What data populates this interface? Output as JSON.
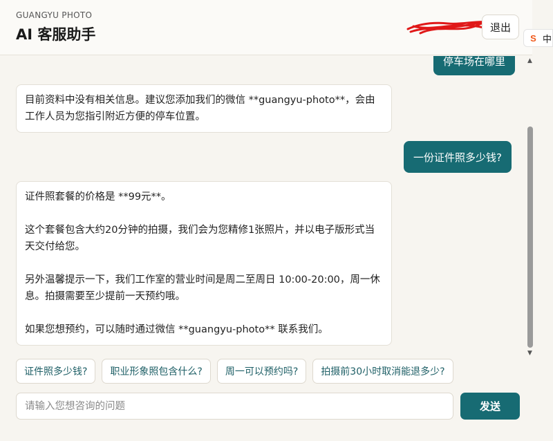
{
  "header": {
    "brand": "GUANGYU PHOTO",
    "title": "AI 客服助手",
    "logout_label": "退出"
  },
  "extension": {
    "icon_letter": "S",
    "label": "中"
  },
  "messages": [
    {
      "role": "user",
      "text": "停车场在哪里"
    },
    {
      "role": "assistant",
      "paragraphs": [
        "目前资料中没有相关信息。建议您添加我们的微信 **guangyu-photo**，会由工作人员为您指引附近方便的停车位置。"
      ]
    },
    {
      "role": "user",
      "text": "一份证件照多少钱?"
    },
    {
      "role": "assistant",
      "paragraphs": [
        "证件照套餐的价格是 **99元**。",
        "这个套餐包含大约20分钟的拍摄，我们会为您精修1张照片，并以电子版形式当天交付给您。",
        "另外温馨提示一下，我们工作室的营业时间是周二至周日 10:00-20:00，周一休息。拍摄需要至少提前一天预约哦。",
        "如果您想预约，可以随时通过微信 **guangyu-photo** 联系我们。"
      ]
    }
  ],
  "suggestions": [
    "证件照多少钱?",
    "职业形象照包含什么?",
    "周一可以预约吗?",
    "拍摄前30小时取消能退多少?"
  ],
  "composer": {
    "placeholder": "请输入您想咨询的问题",
    "send_label": "发送"
  },
  "colors": {
    "accent": "#176b73",
    "background": "#f7f5f0"
  }
}
